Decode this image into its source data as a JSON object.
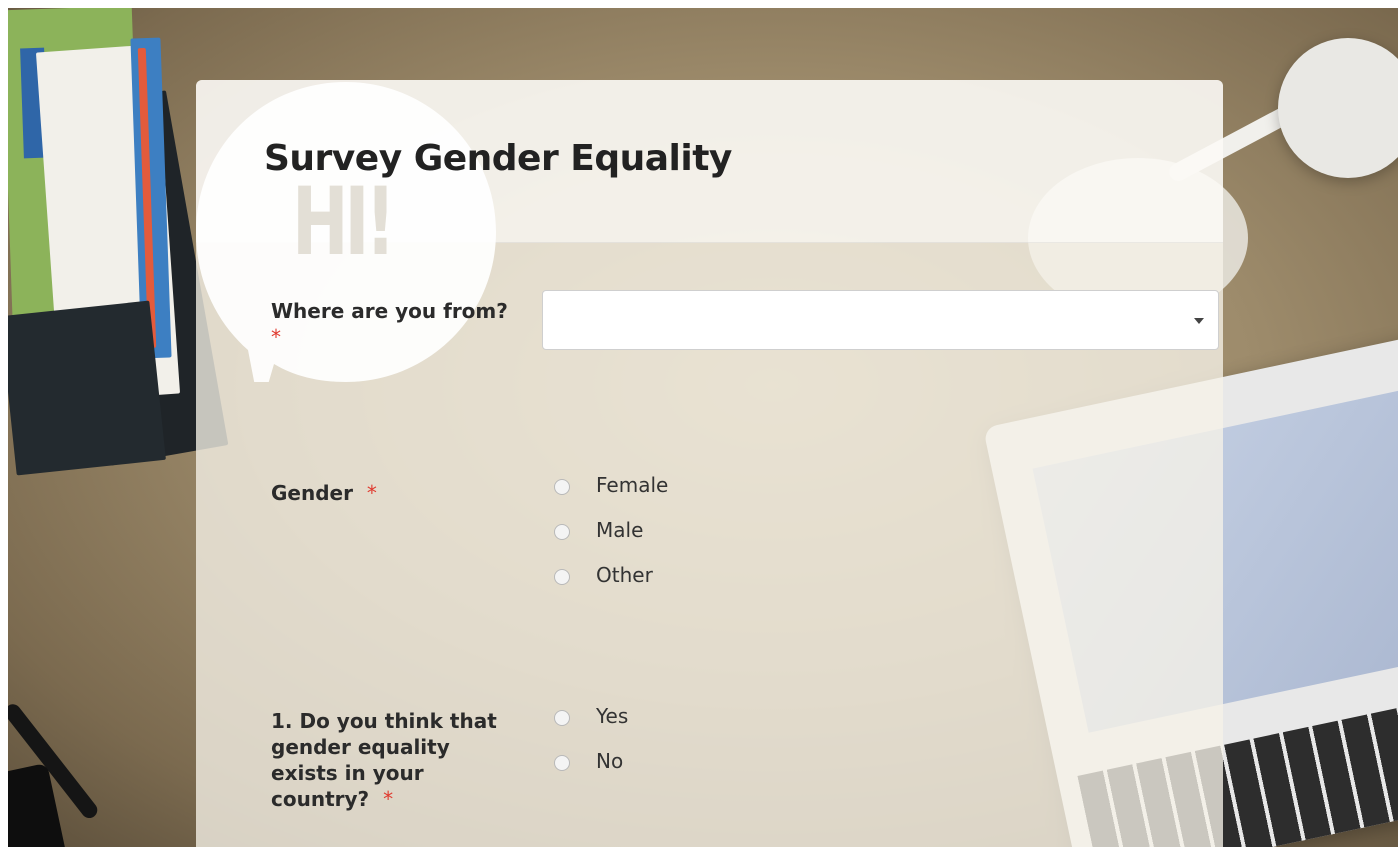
{
  "survey": {
    "title": "Survey Gender Equality",
    "bubble_text": "HI!",
    "required_marker": "*"
  },
  "questions": [
    {
      "id": "origin",
      "label": "Where are you from?",
      "type": "select",
      "value": "",
      "required": true
    },
    {
      "id": "gender",
      "label": "Gender",
      "type": "radio",
      "required": true,
      "options": [
        "Female",
        "Male",
        "Other"
      ]
    },
    {
      "id": "q1",
      "label_lines": [
        "1. Do you think that",
        "gender equality",
        "exists in your",
        "country?"
      ],
      "type": "radio",
      "required": true,
      "options": [
        "Yes",
        "No"
      ]
    }
  ],
  "colors": {
    "required": "#e03a2f",
    "title": "#222222"
  },
  "icons": {
    "select_arrow": "caret-down-icon"
  }
}
